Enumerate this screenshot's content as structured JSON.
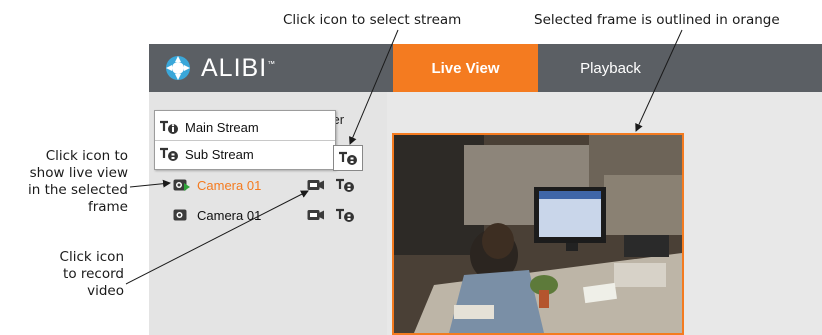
{
  "annotations": {
    "select_stream": "Click icon to select stream",
    "selected_frame": "Selected frame is outlined in orange",
    "live_view": [
      "Click icon to",
      "show live view",
      "in the selected",
      "frame"
    ],
    "record": [
      "Click icon",
      "to record",
      "video"
    ]
  },
  "app": {
    "logo": "ALIBI",
    "logo_tm": "™",
    "tabs": [
      {
        "label": "Live View",
        "active": true
      },
      {
        "label": "Playback",
        "active": false
      }
    ]
  },
  "panel": {
    "recorder_peek": "rder",
    "stream_menu": [
      {
        "label": "Main Stream",
        "icon": "main-stream-icon"
      },
      {
        "label": "Sub Stream",
        "icon": "sub-stream-icon"
      }
    ],
    "cameras": [
      {
        "label": "Camera 01",
        "active": true
      },
      {
        "label": "Camera 01",
        "active": false
      }
    ]
  },
  "colors": {
    "accent": "#f47b20",
    "header_bg": "#5b5f64",
    "panel_bg": "#e4e4e4"
  }
}
